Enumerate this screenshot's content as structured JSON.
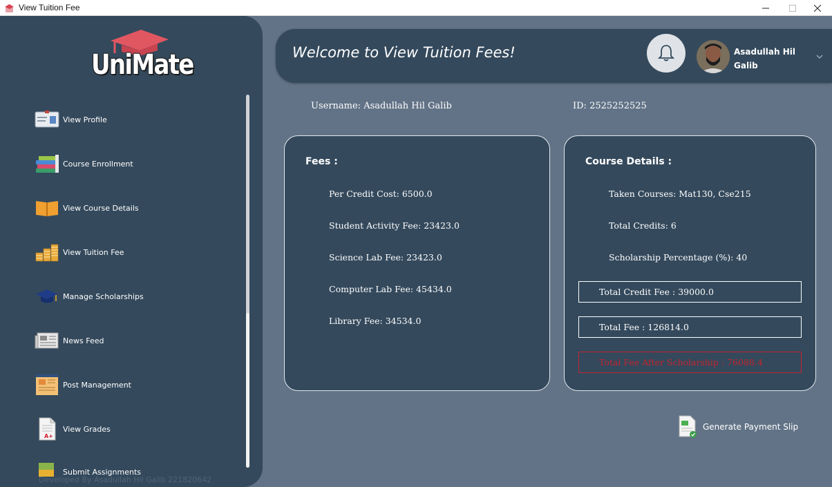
{
  "window": {
    "title": "View Tuition Fee"
  },
  "sidebar": {
    "logo_text": "UniMate",
    "items": [
      {
        "label": "View Profile",
        "icon": "id-card-icon"
      },
      {
        "label": "Course Enrollment",
        "icon": "books-stack-icon"
      },
      {
        "label": "View Course Details",
        "icon": "open-book-icon"
      },
      {
        "label": "View Tuition Fee",
        "icon": "coins-icon"
      },
      {
        "label": "Manage Scholarships",
        "icon": "graduation-cap-icon"
      },
      {
        "label": "News Feed",
        "icon": "newspaper-icon"
      },
      {
        "label": "Post Management",
        "icon": "post-board-icon"
      },
      {
        "label": "View Grades",
        "icon": "grade-sheet-icon"
      },
      {
        "label": "Submit Assignments",
        "icon": "assignment-icon"
      }
    ],
    "footer": "Developed By Asadullah Hil Galib 221820642"
  },
  "header": {
    "welcome": "Welcome to View Tuition Fees!",
    "user_name": "Asadullah Hil Galib"
  },
  "info": {
    "username": "Username: Asadullah Hil Galib",
    "id": "ID: 2525252525"
  },
  "fees": {
    "title": "Fees :",
    "rows": [
      "Per Credit Cost: 6500.0",
      "Student Activity Fee: 23423.0",
      "Science Lab Fee: 23423.0",
      "Computer Lab Fee: 45434.0",
      "Library Fee: 34534.0"
    ]
  },
  "course": {
    "title": "Course Details :",
    "taken": "Taken Courses: Mat130, Cse215",
    "credits": "Total Credits: 6",
    "scholarship": "Scholarship Percentage (%): 40",
    "total_credit_fee": "Total Credit Fee : 39000.0",
    "total_fee": "Total Fee : 126814.0",
    "after_scholarship": "Total Fee After Scholarship : 76088.4"
  },
  "actions": {
    "generate": "Generate Payment Slip"
  },
  "colors": {
    "panel": "#34495c",
    "background": "#627387",
    "accent_red": "#c4242f"
  }
}
